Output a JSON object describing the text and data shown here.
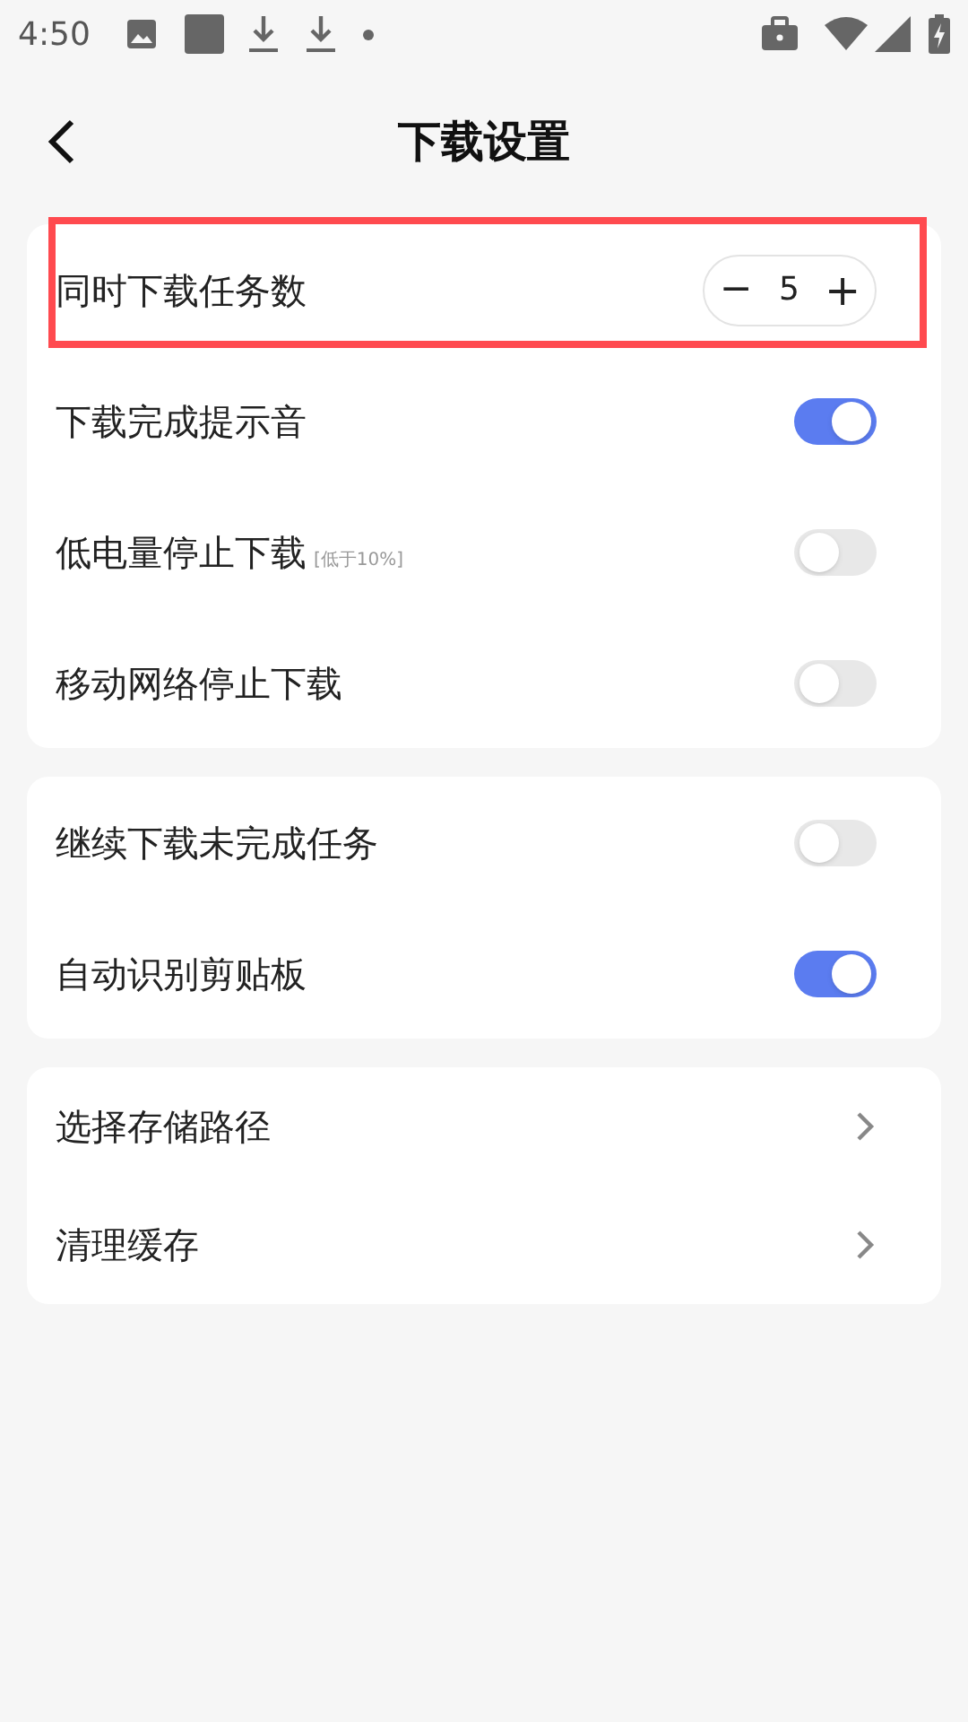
{
  "status_bar": {
    "time": "4:50"
  },
  "header": {
    "title": "下载设置"
  },
  "groups": [
    {
      "items": [
        {
          "kind": "stepper",
          "label": "同时下载任务数",
          "value": "5",
          "minus": "−",
          "plus": "+",
          "highlighted": true
        },
        {
          "kind": "toggle",
          "label": "下载完成提示音",
          "on": true
        },
        {
          "kind": "toggle",
          "label": "低电量停止下载",
          "note": "[低于10%]",
          "on": false
        },
        {
          "kind": "toggle",
          "label": "移动网络停止下载",
          "on": false
        }
      ]
    },
    {
      "items": [
        {
          "kind": "toggle",
          "label": "继续下载未完成任务",
          "on": false
        },
        {
          "kind": "toggle",
          "label": "自动识别剪贴板",
          "on": true
        }
      ]
    },
    {
      "items": [
        {
          "kind": "link",
          "label": "选择存储路径"
        },
        {
          "kind": "link",
          "label": "清理缓存"
        }
      ]
    }
  ]
}
